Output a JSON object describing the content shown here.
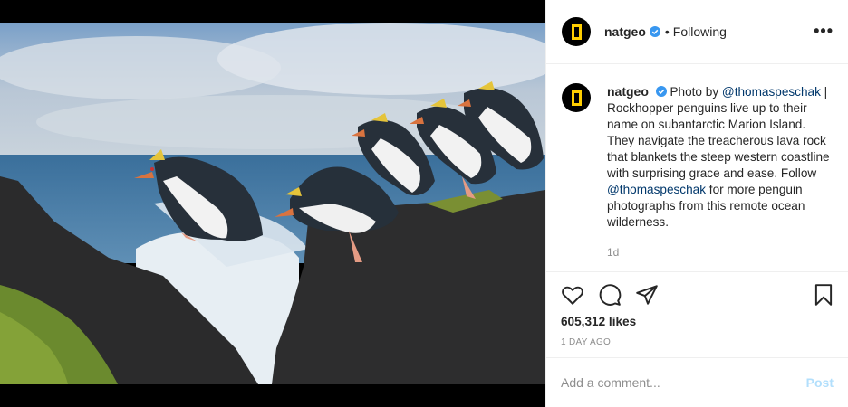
{
  "post": {
    "image_alt": "Rockhopper penguins leaping between lava rocks",
    "icons": {
      "verified": "verified-badge-icon",
      "more": "more-options-icon",
      "like": "heart-icon",
      "comment": "comment-icon",
      "share": "paper-plane-icon",
      "save": "bookmark-icon"
    },
    "colors": {
      "accent": "#0095f6",
      "logo_yellow": "#ffce00",
      "mention": "#00376b",
      "muted": "#8e8e8e"
    }
  },
  "header": {
    "username": "natgeo",
    "separator": "•",
    "follow_status": "Following",
    "more_label": "•••"
  },
  "caption": {
    "username": "natgeo",
    "prefix": "Photo by ",
    "mention1": "@thomaspeschak",
    "text1": " | Rockhopper penguins live up to their name on subantarctic Marion Island. They navigate the treacherous lava rock that blankets the steep western coastline with surprising grace and ease. Follow ",
    "mention2": "@thomaspeschak",
    "text2": " for more penguin photographs from this remote ocean wilderness.",
    "time_ago": "1d"
  },
  "stats": {
    "likes": "605,312 likes",
    "posted": "1 DAY AGO"
  },
  "comment_box": {
    "placeholder": "Add a comment...",
    "post_label": "Post"
  }
}
